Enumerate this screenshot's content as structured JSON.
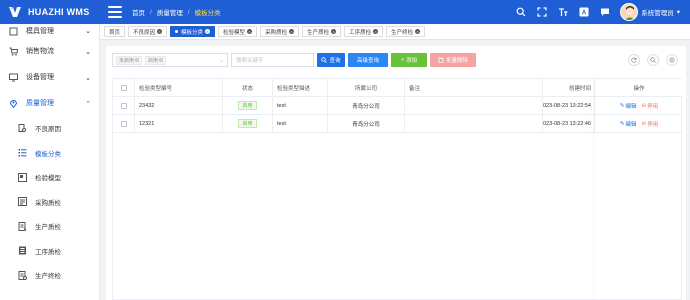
{
  "app": {
    "title": "HUAZHI WMS"
  },
  "breadcrumb": [
    "首页",
    "质量管理",
    "模板分类"
  ],
  "header": {
    "user_name": "系统管理员"
  },
  "sidebar": {
    "items": [
      {
        "label": "模具管理",
        "icon": "box-icon"
      },
      {
        "label": "销售物流",
        "icon": "cart-icon"
      },
      {
        "label": "设备管理",
        "icon": "monitor-icon"
      },
      {
        "label": "质量管理",
        "icon": "location-icon"
      }
    ],
    "subitems": [
      {
        "label": "不良原因",
        "icon": "doc-search-icon"
      },
      {
        "label": "模板分类",
        "icon": "list-icon"
      },
      {
        "label": "检验模型",
        "icon": "model-icon"
      },
      {
        "label": "采购质检",
        "icon": "purchase-icon"
      },
      {
        "label": "生产质检",
        "icon": "production-icon"
      },
      {
        "label": "工序质检",
        "icon": "process-icon"
      },
      {
        "label": "生产终检",
        "icon": "final-check-icon"
      }
    ]
  },
  "tabs": [
    {
      "label": "首页"
    },
    {
      "label": "不良原因"
    },
    {
      "label": "模板分类"
    },
    {
      "label": "检验模型"
    },
    {
      "label": "采购质检"
    },
    {
      "label": "生产质检"
    },
    {
      "label": "工序质检"
    },
    {
      "label": "生产终检"
    }
  ],
  "filter": {
    "chips": [
      "未启用",
      "启用"
    ],
    "keyword_placeholder": "搜索关键字",
    "search_label": "查询",
    "advanced_label": "高级查询",
    "add_label": "添加",
    "batch_delete_label": "批量删除"
  },
  "table": {
    "columns": [
      "检验类型编号",
      "状态",
      "检验类型描述",
      "所属公司",
      "备注",
      "创建时间",
      "操作"
    ],
    "rows": [
      {
        "code": "23432",
        "status": "启用",
        "desc": "test",
        "company": "青岛分公司",
        "remark": "",
        "created": "2023-08-23 13:22:54",
        "edit": "编辑",
        "stop": "停用"
      },
      {
        "code": "12321",
        "status": "启用",
        "desc": "test",
        "company": "青岛分公司",
        "remark": "",
        "created": "2023-08-23 13:22:46",
        "edit": "编辑",
        "stop": "停用"
      }
    ]
  },
  "colors": {
    "primary": "#1f5ed4",
    "success": "#67c23a",
    "danger": "#f56c6c",
    "highlight": "#ffd84d"
  }
}
